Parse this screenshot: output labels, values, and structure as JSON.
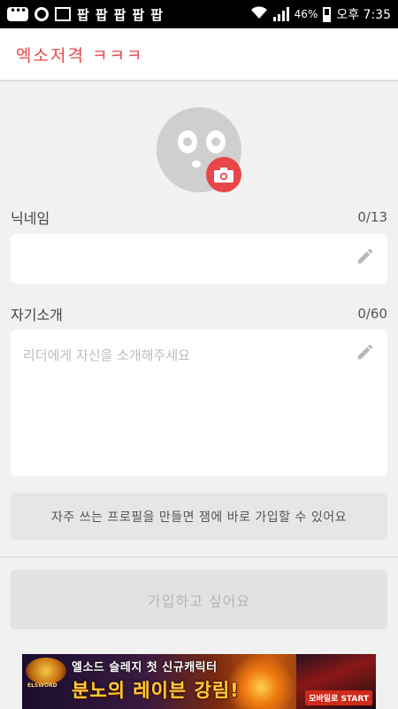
{
  "status_bar": {
    "app_icons": [
      "팝",
      "팝",
      "팝",
      "팝",
      "팝"
    ],
    "battery": "46%",
    "time": "오후 7:35"
  },
  "header": {
    "title": "엑소저격 ㅋㅋㅋ"
  },
  "profile": {
    "avatar_icon": "avatar-placeholder-icon",
    "camera_icon": "camera-icon"
  },
  "nickname": {
    "label": "닉네임",
    "counter": "0/13",
    "value": "",
    "placeholder": "",
    "icon": "pencil-icon"
  },
  "intro": {
    "label": "자기소개",
    "counter": "0/60",
    "value": "",
    "placeholder": "리더에게 자신을 소개해주세요",
    "icon": "pencil-icon"
  },
  "info_box": {
    "text": "자주 쓰는 프로필을 만들면 잼에 바로 가입할 수 있어요"
  },
  "join_button": {
    "label": "가입하고 싶어요"
  },
  "ad": {
    "logo_text": "ELSWORD",
    "line1": "엘소드 슬레지 첫 신규캐릭터",
    "line2": "분노의 레이븐 강림!",
    "cta": "모바일로 START"
  },
  "colors": {
    "accent": "#e8474a",
    "background": "#f1f1f1",
    "field_bg": "#ffffff",
    "disabled_button": "#e2e2e2"
  }
}
